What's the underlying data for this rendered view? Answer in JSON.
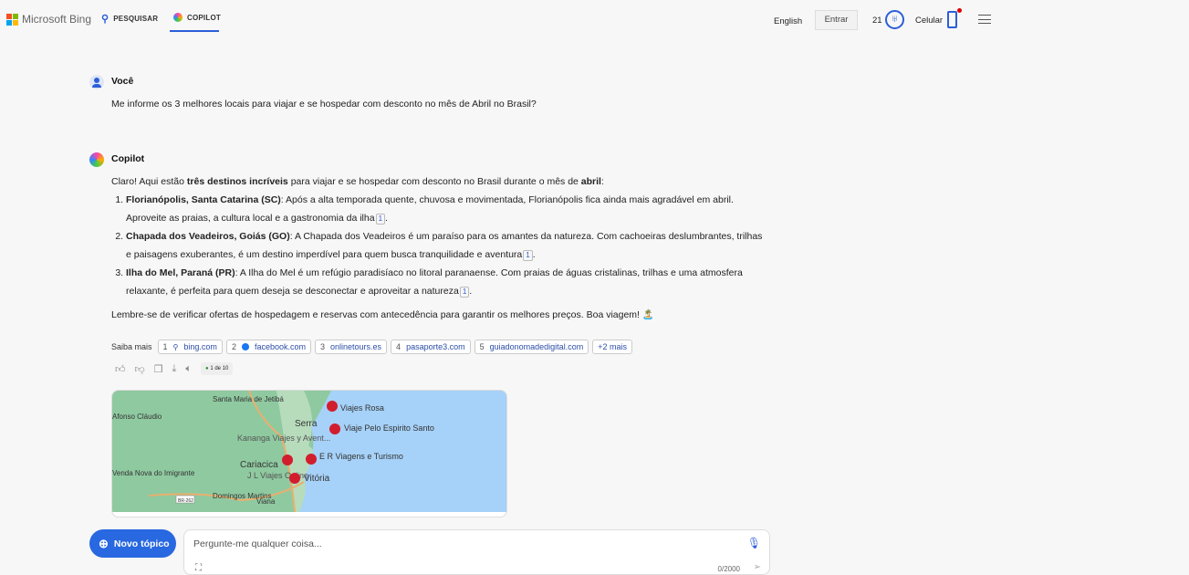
{
  "header": {
    "brand": "Microsoft Bing",
    "nav": [
      {
        "label": "PESQUISAR"
      },
      {
        "label": "COPILOT"
      }
    ],
    "language": "English",
    "signin": "Entrar",
    "rewards_count": "21",
    "mobile": "Celular"
  },
  "user_msg": {
    "author": "Você",
    "text": "Me informe os 3 melhores locais para viajar e se hospedar com desconto no mês de Abril no Brasil?"
  },
  "bot_msg": {
    "author": "Copilot",
    "intro_a": "Claro! Aqui estão ",
    "intro_b": "três destinos incríveis",
    "intro_c": " para viajar e se hospedar com desconto no Brasil durante o mês de ",
    "intro_d": "abril",
    "intro_e": ":",
    "items": [
      {
        "title": "Florianópolis, Santa Catarina (SC)",
        "text": ": Após a alta temporada quente, chuvosa e movimentada, Florianópolis fica ainda mais agradável em abril. Aproveite as praias, a cultura local e a gastronomia da ilha",
        "cite": "1"
      },
      {
        "title": "Chapada dos Veadeiros, Goiás (GO)",
        "text": ": A Chapada dos Veadeiros é um paraíso para os amantes da natureza. Com cachoeiras deslumbrantes, trilhas e paisagens exuberantes, é um destino imperdível para quem busca tranquilidade e aventura",
        "cite": "1"
      },
      {
        "title": "Ilha do Mel, Paraná (PR)",
        "text": ": A Ilha do Mel é um refúgio paradisíaco no litoral paranaense. Com praias de águas cristalinas, trilhas e uma atmosfera relaxante, é perfeita para quem deseja se desconectar e aproveitar a natureza",
        "cite": "1"
      }
    ],
    "closing": "Lembre-se de verificar ofertas de hospedagem e reservas com antecedência para garantir os melhores preços. Boa viagem! 🏝️",
    "learn_more": "Saiba mais",
    "sources": [
      {
        "n": "1",
        "site": "bing.com"
      },
      {
        "n": "2",
        "site": "facebook.com"
      },
      {
        "n": "3",
        "site": "onlinetours.es"
      },
      {
        "n": "4",
        "site": "pasaporte3.com"
      },
      {
        "n": "5",
        "site": "guiadonomadedigital.com"
      }
    ],
    "more": "+2 mais",
    "page": "1 de 10"
  },
  "map": {
    "places": [
      "Santa Maria de Jetibá",
      "Afonso Cláudio",
      "Serra",
      "Cariacica",
      "Vitória",
      "Venda Nova do Imigrante",
      "Domingos Martins",
      "Viana",
      "BR-262"
    ],
    "pins": [
      "Viajes Rosa",
      "Viaje Pelo Espirito Santo",
      "Kananga Viajes y Avent...",
      "E R Viagens e Turismo",
      "J L Viajes Online"
    ]
  },
  "composer": {
    "new_topic": "Novo tópico",
    "placeholder": "Pergunte-me qualquer coisa...",
    "counter": "0/2000"
  }
}
